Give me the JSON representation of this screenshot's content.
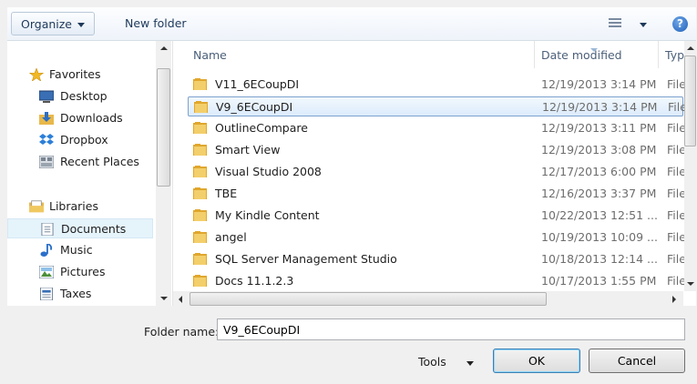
{
  "toolbar": {
    "organize_label": "Organize",
    "new_folder_label": "New folder",
    "help_glyph": "?"
  },
  "nav": {
    "items": [
      {
        "label": "Favorites",
        "icon": "star-icon"
      },
      {
        "label": "Desktop",
        "icon": "desktop-icon"
      },
      {
        "label": "Downloads",
        "icon": "downloads-icon"
      },
      {
        "label": "Dropbox",
        "icon": "dropbox-icon"
      },
      {
        "label": "Recent Places",
        "icon": "recent-places-icon"
      },
      {
        "label": "Libraries",
        "icon": "libraries-icon"
      },
      {
        "label": "Documents",
        "icon": "documents-icon"
      },
      {
        "label": "Music",
        "icon": "music-icon"
      },
      {
        "label": "Pictures",
        "icon": "pictures-icon"
      },
      {
        "label": "Taxes",
        "icon": "taxes-icon"
      }
    ],
    "selected": "Documents"
  },
  "list": {
    "columns": {
      "name": "Name",
      "date": "Date modified",
      "type": "Typ"
    },
    "rows": [
      {
        "name": "V11_6ECoupDI",
        "date": "12/19/2013 3:14 PM",
        "type": "File"
      },
      {
        "name": "V9_6ECoupDI",
        "date": "12/19/2013 3:14 PM",
        "type": "File"
      },
      {
        "name": "OutlineCompare",
        "date": "12/19/2013 3:11 PM",
        "type": "File"
      },
      {
        "name": "Smart View",
        "date": "12/19/2013 3:08 PM",
        "type": "File"
      },
      {
        "name": "Visual Studio 2008",
        "date": "12/17/2013 6:00 PM",
        "type": "File"
      },
      {
        "name": "TBE",
        "date": "12/16/2013 3:37 PM",
        "type": "File"
      },
      {
        "name": "My Kindle Content",
        "date": "10/22/2013 12:51 ...",
        "type": "File"
      },
      {
        "name": "angel",
        "date": "10/19/2013 10:09 ...",
        "type": "File"
      },
      {
        "name": "SQL Server Management Studio",
        "date": "10/18/2013 12:14 ...",
        "type": "File"
      },
      {
        "name": "Docs 11.1.2.3",
        "date": "10/17/2013 1:55 PM",
        "type": "File"
      }
    ],
    "selected": "V9_6ECoupDI"
  },
  "footer": {
    "folder_name_label": "Folder name:",
    "folder_name_value": "V9_6ECoupDI",
    "tools_label": "Tools",
    "ok_label": "OK",
    "cancel_label": "Cancel"
  },
  "colors": {
    "folder": "#e8b84a",
    "selection": "#dcebfc",
    "accent": "#3c7fb1"
  }
}
